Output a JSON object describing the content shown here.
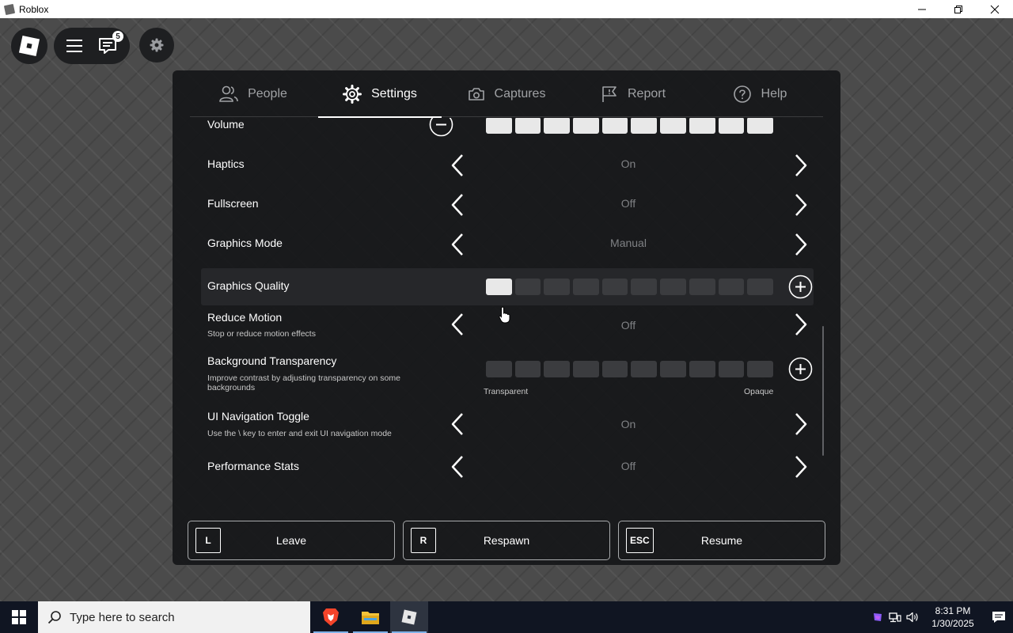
{
  "window": {
    "title": "Roblox"
  },
  "topbar": {
    "chat_badge": "5"
  },
  "tabs": [
    {
      "label": "People",
      "icon": "people-icon",
      "active": false
    },
    {
      "label": "Settings",
      "icon": "gear-icon",
      "active": true
    },
    {
      "label": "Captures",
      "icon": "camera-icon",
      "active": false
    },
    {
      "label": "Report",
      "icon": "flag-icon",
      "active": false
    },
    {
      "label": "Help",
      "icon": "help-icon",
      "active": false
    }
  ],
  "settings": {
    "volume": {
      "label": "Volume",
      "level": 10,
      "max": 10
    },
    "haptics": {
      "label": "Haptics",
      "value": "On"
    },
    "fullscreen": {
      "label": "Fullscreen",
      "value": "Off"
    },
    "graphics_mode": {
      "label": "Graphics Mode",
      "value": "Manual"
    },
    "graphics_quality": {
      "label": "Graphics Quality",
      "level": 1,
      "max": 10
    },
    "reduce_motion": {
      "label": "Reduce Motion",
      "description": "Stop or reduce motion effects",
      "value": "Off"
    },
    "background_transparency": {
      "label": "Background Transparency",
      "description": "Improve contrast by adjusting transparency on some backgrounds",
      "level": 0,
      "max": 10,
      "min_label": "Transparent",
      "max_label": "Opaque"
    },
    "ui_navigation_toggle": {
      "label": "UI Navigation Toggle",
      "description": "Use the \\ key to enter and exit UI navigation mode",
      "value": "On"
    },
    "performance_stats": {
      "label": "Performance Stats",
      "value": "Off"
    }
  },
  "footer": {
    "leave": {
      "key": "L",
      "label": "Leave"
    },
    "respawn": {
      "key": "R",
      "label": "Respawn"
    },
    "resume": {
      "key": "ESC",
      "label": "Resume"
    }
  },
  "taskbar": {
    "search_placeholder": "Type here to search",
    "time": "8:31 PM",
    "date": "1/30/2025"
  },
  "colors": {
    "panel_bg": "#161719",
    "segment_on": "#e8e8e8",
    "segment_off": "#3b3c3f",
    "value_text": "#7f8184",
    "taskbar_bg": "#101522"
  }
}
